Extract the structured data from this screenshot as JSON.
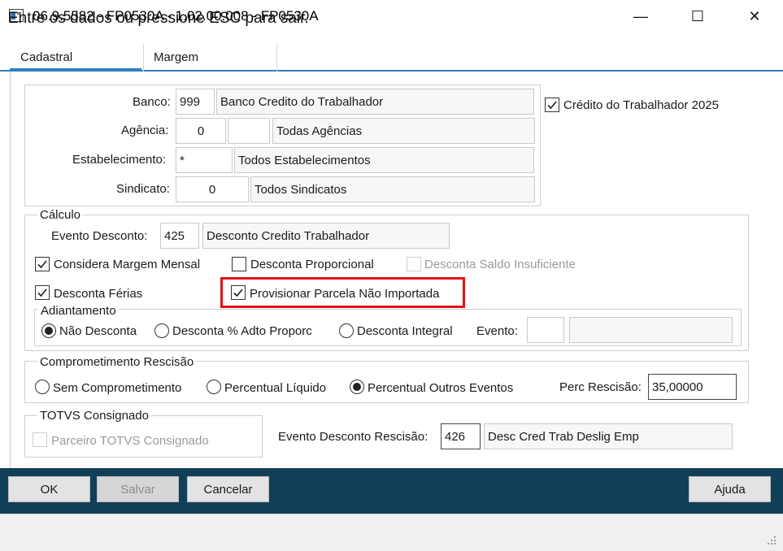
{
  "window": {
    "title": "06.9.5582 - FP0530A - 1.02.00.008 - FP0530A",
    "minimize": "—",
    "maximize": "☐",
    "close": "✕"
  },
  "tabs": [
    {
      "label": "Cadastral"
    },
    {
      "label": "Margem"
    }
  ],
  "cadastro": {
    "banco_label": "Banco:",
    "banco_code": "999",
    "banco_name": "Banco Credito do Trabalhador",
    "agencia_label": "Agência:",
    "agencia_code": "0",
    "agencia_extra": "",
    "agencia_name": "Todas Agências",
    "estab_label": "Estabelecimento:",
    "estab_code": "*",
    "estab_name": "Todos Estabelecimentos",
    "sindicato_label": "Sindicato:",
    "sindicato_code": "0",
    "sindicato_name": "Todos Sindicatos",
    "credito_label": "Crédito do Trabalhador 2025",
    "credito_checked": true
  },
  "calculo": {
    "title": "Cálculo",
    "evento_label": "Evento Desconto:",
    "evento_code": "425",
    "evento_name": "Desconto Credito Trabalhador",
    "considera_margem": "Considera Margem Mensal",
    "desconta_proporcional": "Desconta Proporcional",
    "desconta_saldo": "Desconta Saldo Insuficiente",
    "desconta_ferias": "Desconta Férias",
    "provisionar": "Provisionar Parcela Não Importada"
  },
  "adiantamento": {
    "title": "Adiantamento",
    "options": [
      "Não Desconta",
      "Desconta % Adto Proporc",
      "Desconta Integral"
    ],
    "selected": 0,
    "evento_label": "Evento:",
    "evento_code": "",
    "evento_name": ""
  },
  "rescisao": {
    "title": "Comprometimento Rescisão",
    "options": [
      "Sem Comprometimento",
      "Percentual Líquido",
      "Percentual Outros Eventos"
    ],
    "selected": 2,
    "perc_label": "Perc Rescisão:",
    "perc_value": "35,00000"
  },
  "totvs": {
    "title": "TOTVS Consignado",
    "parceiro": "Parceiro TOTVS Consignado"
  },
  "evento_rescisao": {
    "label": "Evento Desconto Rescisão:",
    "code": "426",
    "name": "Desc Cred Trab Deslig Emp"
  },
  "buttons": {
    "ok": "OK",
    "salvar": "Salvar",
    "cancelar": "Cancelar",
    "ajuda": "Ajuda"
  },
  "status": {
    "text": "Entre os dados ou pressione ESC para sair."
  },
  "colors": {
    "accent": "#2f7fc3",
    "button_bar": "#123f58",
    "highlight": "#e3101a"
  }
}
